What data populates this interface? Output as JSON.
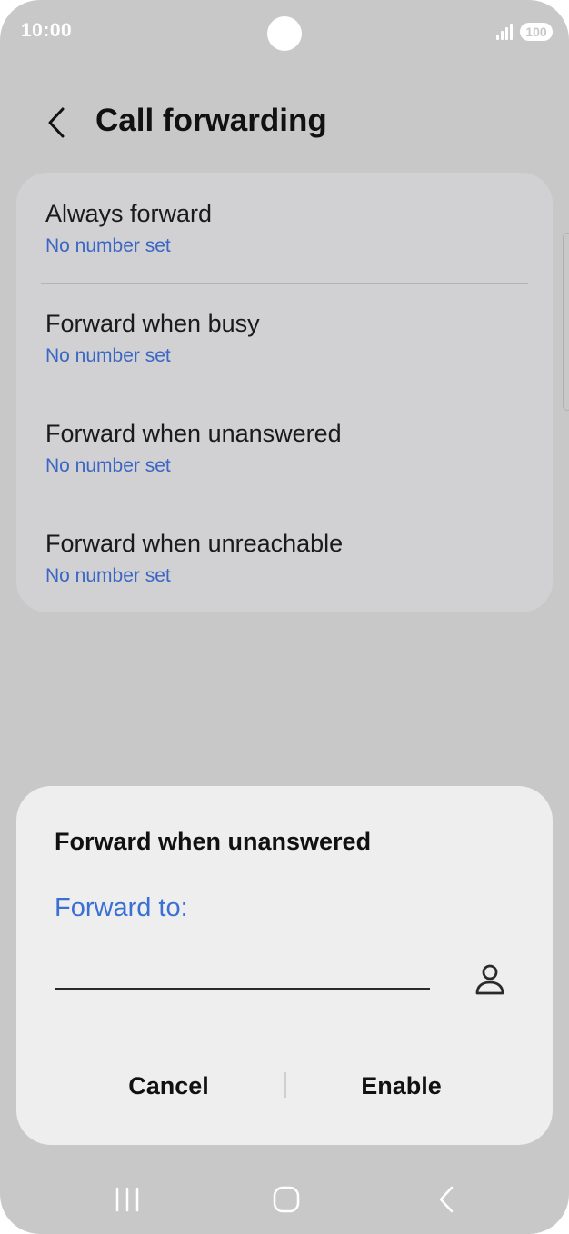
{
  "status_bar": {
    "time": "10:00",
    "battery": "100"
  },
  "header": {
    "title": "Call forwarding",
    "back_icon": "chevron-left-icon"
  },
  "forwarding_options": [
    {
      "title": "Always forward",
      "subtitle": "No number set"
    },
    {
      "title": "Forward when busy",
      "subtitle": "No number set"
    },
    {
      "title": "Forward when unanswered",
      "subtitle": "No number set"
    },
    {
      "title": "Forward when unreachable",
      "subtitle": "No number set"
    }
  ],
  "dialog": {
    "title": "Forward when unanswered",
    "label": "Forward to:",
    "input_value": "",
    "contact_icon": "contact-person-icon",
    "cancel_label": "Cancel",
    "enable_label": "Enable"
  },
  "nav_bar": {
    "recents_icon": "recents-icon",
    "home_icon": "home-icon",
    "back_icon": "back-icon"
  },
  "colors": {
    "accent": "#3a6fd4",
    "subtitle": "#3a66c4",
    "screen_dim": "#c8c8c8",
    "card": "#d1d1d4",
    "dialog": "#eeeeee"
  }
}
